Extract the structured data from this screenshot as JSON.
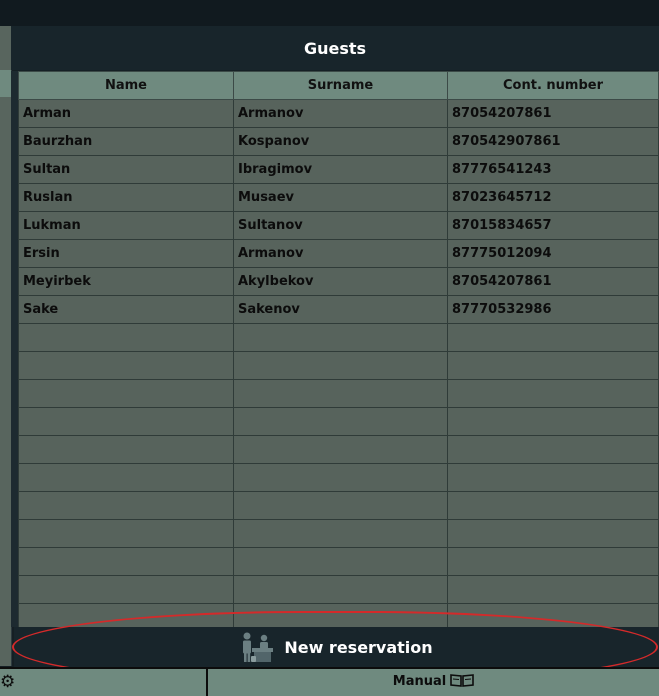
{
  "panel": {
    "title": "Guests"
  },
  "table": {
    "columns": [
      "Name",
      "Surname",
      "Cont. number"
    ],
    "rows": [
      [
        "Arman",
        "Armanov",
        "87054207861"
      ],
      [
        "Baurzhan",
        "Kospanov",
        "870542907861"
      ],
      [
        "Sultan",
        "Ibragimov",
        "87776541243"
      ],
      [
        "Ruslan",
        "Musaev",
        "87023645712"
      ],
      [
        "Lukman",
        "Sultanov",
        "87015834657"
      ],
      [
        "Ersin",
        "Armanov",
        "87775012094"
      ],
      [
        "Meyirbek",
        "Akylbekov",
        "87054207861"
      ],
      [
        "Sake",
        "Sakenov",
        "87770532986"
      ],
      [
        "",
        "",
        ""
      ],
      [
        "",
        "",
        ""
      ],
      [
        "",
        "",
        ""
      ],
      [
        "",
        "",
        ""
      ],
      [
        "",
        "",
        ""
      ],
      [
        "",
        "",
        ""
      ],
      [
        "",
        "",
        ""
      ],
      [
        "",
        "",
        ""
      ],
      [
        "",
        "",
        ""
      ],
      [
        "",
        "",
        ""
      ],
      [
        "",
        "",
        ""
      ]
    ]
  },
  "actions": {
    "new_reservation_label": "New reservation",
    "new_reservation_icon": "reception-desk-icon"
  },
  "footer": {
    "manual_label": "Manual",
    "manual_icon": "book-icon",
    "settings_icon": "gear-icon"
  },
  "colors": {
    "highlight": "#d42a2a",
    "header": "#6f8a7f",
    "cell": "#57635c",
    "panel": "#18252b"
  }
}
